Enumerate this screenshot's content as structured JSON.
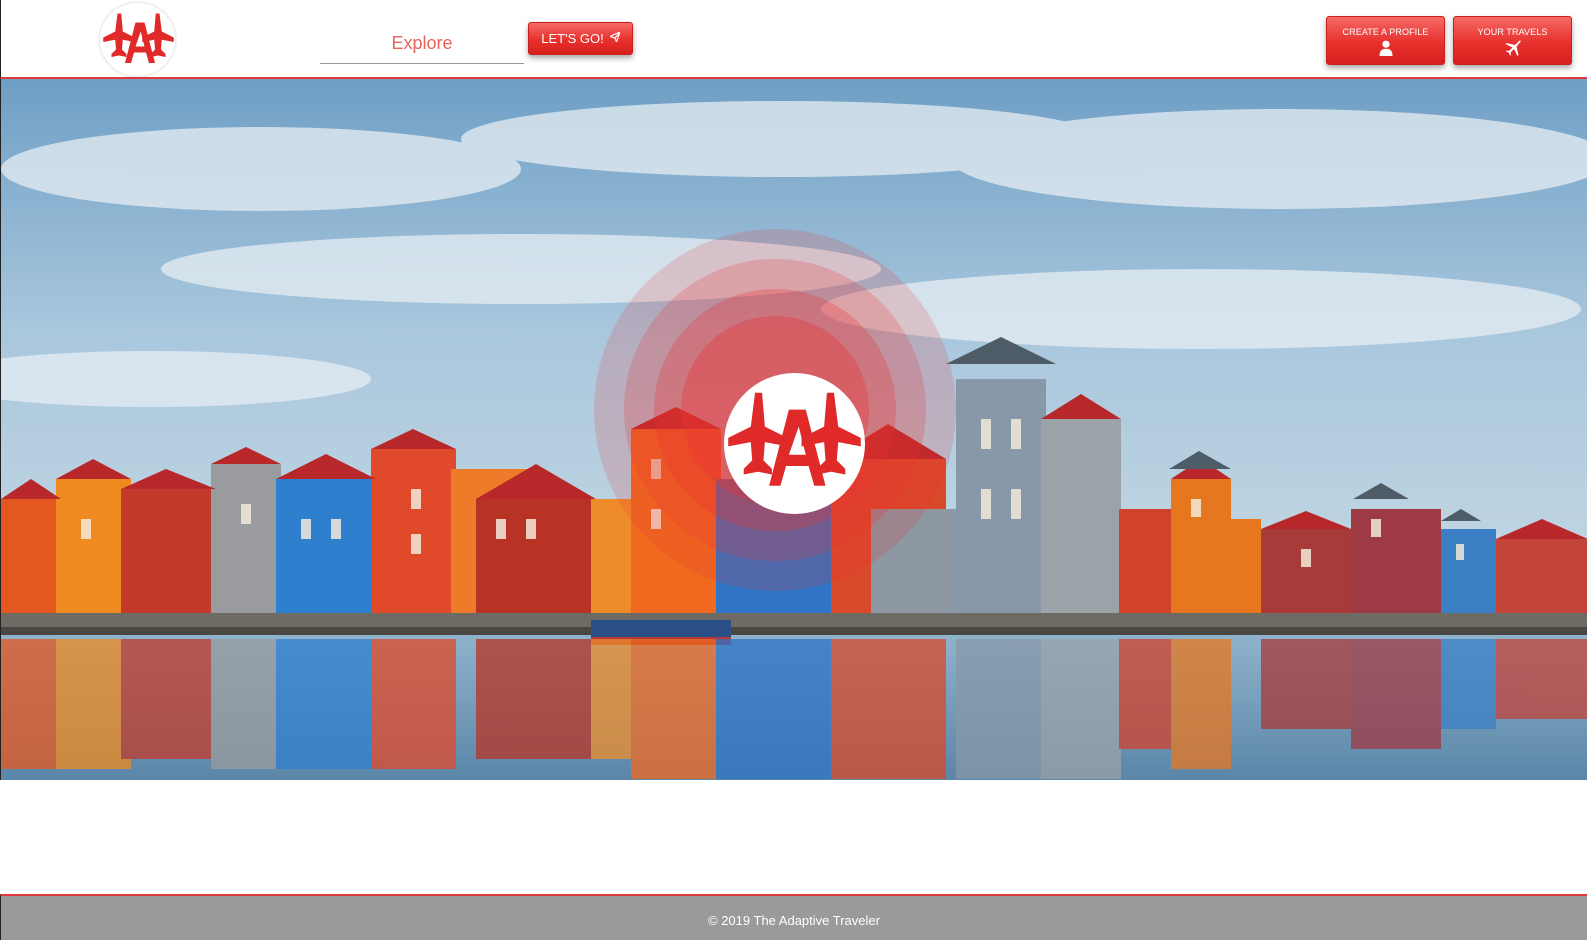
{
  "header": {
    "search": {
      "placeholder": "Explore",
      "value": ""
    },
    "go_button": {
      "label": "LET'S GO!",
      "icon": "paper-plane-icon"
    },
    "profile_button": {
      "label": "CREATE A PROFILE",
      "icon": "user-icon"
    },
    "travels_button": {
      "label": "YOUR TRAVELS",
      "icon": "airplane-icon"
    },
    "logo": {
      "icon": "adaptive-traveler-logo"
    }
  },
  "hero": {
    "background": "colorful waterfront houses reflected in water",
    "logo": {
      "icon": "adaptive-traveler-logo"
    }
  },
  "footer": {
    "copyright": "© 2019 The Adaptive Traveler"
  },
  "colors": {
    "brand_red": "#e8302c",
    "footer_gray": "#9a9a9a",
    "placeholder_red": "#e8625e"
  }
}
